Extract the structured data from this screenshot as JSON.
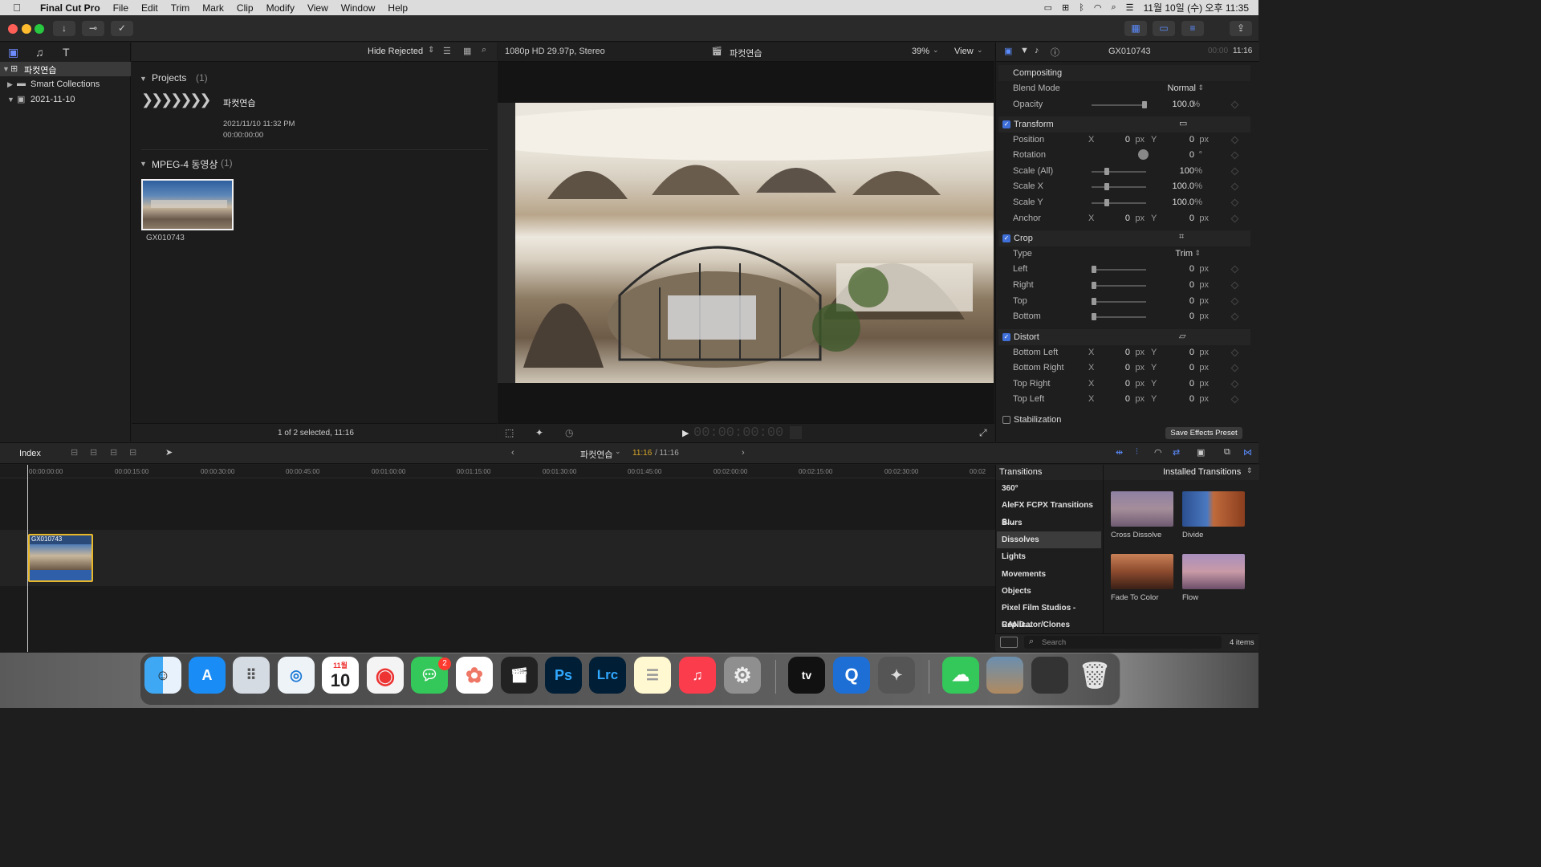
{
  "menubar": {
    "app": "Final Cut Pro",
    "items": [
      "File",
      "Edit",
      "Trim",
      "Mark",
      "Clip",
      "Modify",
      "View",
      "Window",
      "Help"
    ],
    "datetime": "11월 10일 (수) 오후 11:35"
  },
  "browser": {
    "library": "파컷연습",
    "smart_collections": "Smart Collections",
    "event": "2021-11-10",
    "filter": "Hide Rejected",
    "projects_label": "Projects",
    "projects_count": "(1)",
    "project_name": "파컷연습",
    "project_date": "2021/11/10 11:32 PM",
    "project_duration": "00:00:00:00",
    "media_label": "MPEG-4 동영상",
    "media_count": "(1)",
    "clip_name": "GX010743",
    "status": "1 of 2 selected, 11:16"
  },
  "viewer": {
    "format": "1080p HD 29.97p, Stereo",
    "project": "파컷연습",
    "zoom": "39%",
    "view": "View",
    "timecode": "00:00:00:00"
  },
  "inspector": {
    "clip": "GX010743",
    "duration_dim": "00:00",
    "duration": "11:16",
    "compositing": "Compositing",
    "blend_mode_label": "Blend Mode",
    "blend_mode": "Normal",
    "opacity_label": "Opacity",
    "opacity": "100.0",
    "pct": "%",
    "transform": "Transform",
    "position": "Position",
    "rotation": "Rotation",
    "scale_all": "Scale (All)",
    "scale_x": "Scale X",
    "scale_y": "Scale Y",
    "anchor": "Anchor",
    "zero": "0",
    "px": "px",
    "deg": "°",
    "hundred": "100",
    "hundred_dec": "100.0",
    "x": "X",
    "y": "Y",
    "crop": "Crop",
    "type_label": "Type",
    "type": "Trim",
    "left": "Left",
    "right": "Right",
    "top": "Top",
    "bottom": "Bottom",
    "distort": "Distort",
    "bottom_left": "Bottom Left",
    "bottom_right": "Bottom Right",
    "top_right": "Top Right",
    "top_left": "Top Left",
    "stabilization": "Stabilization",
    "save_preset": "Save Effects Preset"
  },
  "timeline": {
    "index": "Index",
    "project": "파컷연습",
    "position": "11:16",
    "total": "/ 11:16",
    "ticks": [
      "00:00:00:00",
      "00:00:15:00",
      "00:00:30:00",
      "00:00:45:00",
      "00:01:00:00",
      "00:01:15:00",
      "00:01:30:00",
      "00:01:45:00",
      "00:02:00:00",
      "00:02:15:00",
      "00:02:30:00",
      "00:02"
    ],
    "clip": "GX010743"
  },
  "transitions": {
    "title": "Transitions",
    "installed": "Installed Transitions",
    "categories": [
      "360°",
      "AleFX FCPX Transitions S...",
      "Blurs",
      "Dissolves",
      "Lights",
      "Movements",
      "Objects",
      "Pixel Film Studios - CAND...",
      "Replicator/Clones"
    ],
    "selected_index": 3,
    "items": [
      "Cross Dissolve",
      "Divide",
      "Fade To Color",
      "Flow"
    ],
    "search_placeholder": "Search",
    "count": "4 items"
  },
  "dock": {
    "calendar_month": "11월",
    "calendar_day": "10",
    "messages_badge": "2",
    "ps": "Ps",
    "lrc": "Lrc"
  },
  "colors": {
    "accent": "#3f6fd8",
    "clip_border": "#e8b72a",
    "timecode": "#d9a82a"
  }
}
